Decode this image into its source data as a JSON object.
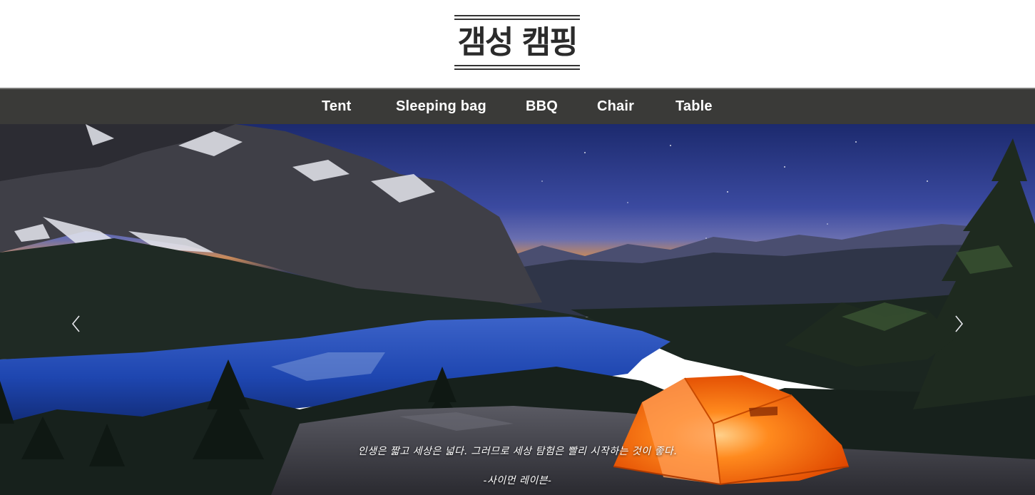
{
  "header": {
    "logo_text": "갬성 캠핑"
  },
  "nav": {
    "items": [
      {
        "label": "Tent"
      },
      {
        "label": "Sleeping bag"
      },
      {
        "label": "BBQ"
      },
      {
        "label": "Chair"
      },
      {
        "label": "Table"
      }
    ]
  },
  "hero": {
    "quote": "인생은 짧고 세상은 넓다. 그러므로 세상 탐험은 빨리 시작하는 것이 좋다.",
    "author": "-사이먼 레이븐-",
    "prev_icon": "chevron-left-icon",
    "next_icon": "chevron-right-icon"
  },
  "colors": {
    "nav_background": "#3a3a38",
    "logo_color": "#2b2b2b",
    "tent_orange": "#ff6a00"
  }
}
